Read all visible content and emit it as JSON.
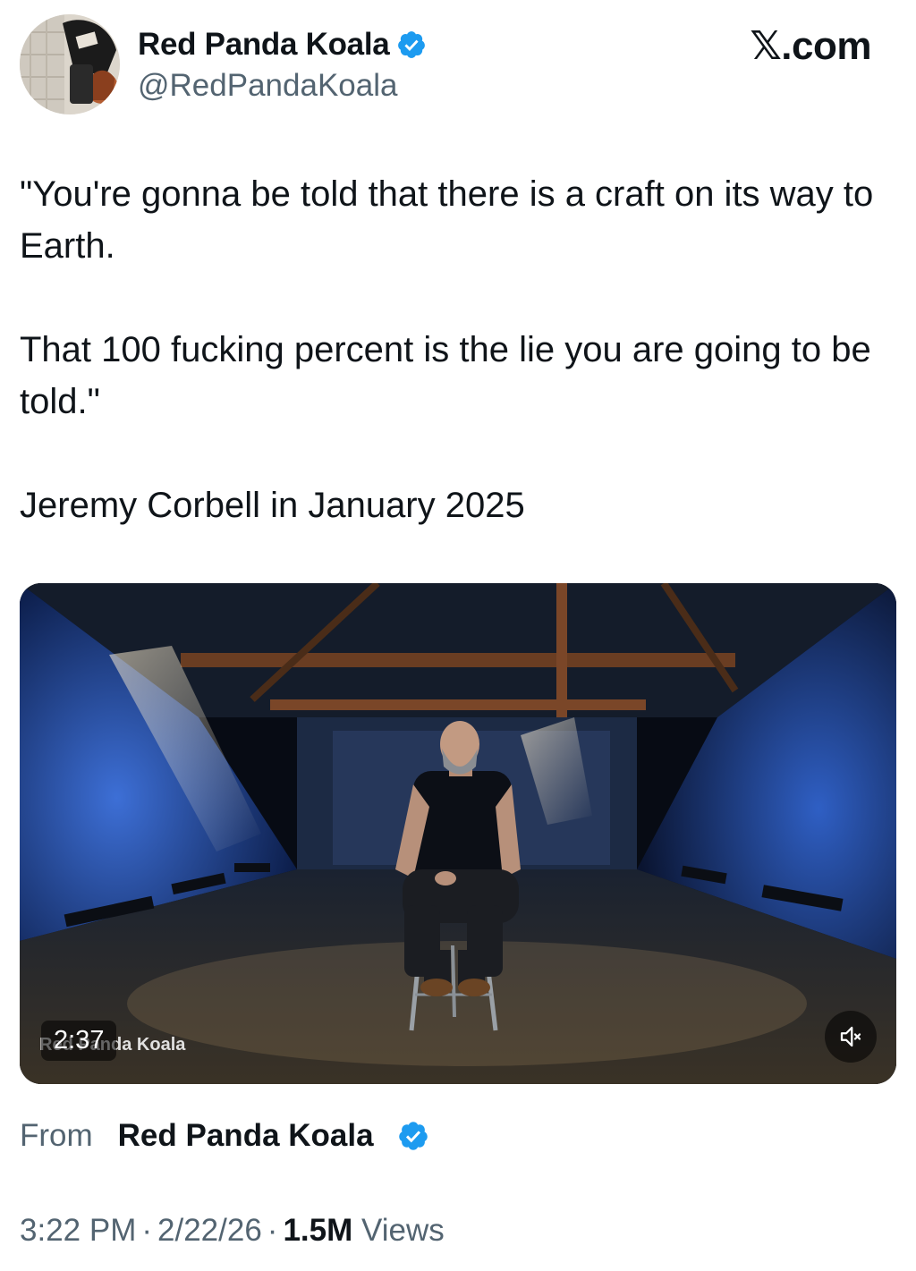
{
  "author": {
    "display_name": "Red Panda Koala",
    "handle": "@RedPandaKoala",
    "verified_icon": "verified-badge-icon",
    "avatar_icon": "avatar-photo"
  },
  "brand": {
    "logo_text": "𝕏.com"
  },
  "tweet": {
    "paragraphs": [
      "\"You're gonna be told that there is a craft on its way to Earth.",
      "That 100 fucking percent is the lie you are going to be told.\"",
      "Jeremy Corbell in January 2025"
    ]
  },
  "video": {
    "duration": "2:37",
    "watermark": "Red Panda Koala",
    "mute_icon": "volume-muted-icon"
  },
  "source": {
    "from_label": "From",
    "name": "Red Panda Koala"
  },
  "meta": {
    "time": "3:22 PM",
    "separator": "·",
    "date": "2/22/26",
    "views_count": "1.5M",
    "views_label": "Views"
  },
  "colors": {
    "verified_blue": "#1d9bf0",
    "secondary_text": "#536471",
    "primary_text": "#0f1419"
  }
}
